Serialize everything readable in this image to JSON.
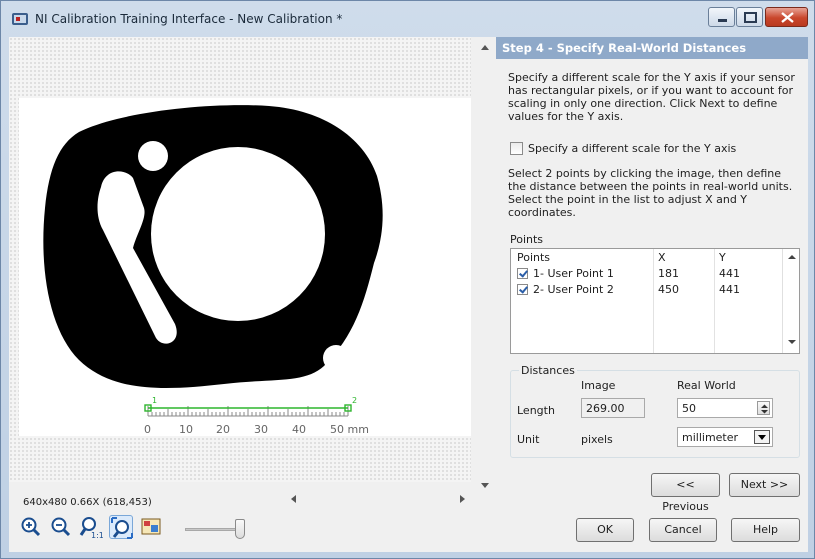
{
  "window": {
    "title": "NI Calibration Training Interface - New Calibration *"
  },
  "step": {
    "header": "Step 4 - Specify Real-World Distances",
    "description": "Specify a different scale for the Y axis if your sensor has rectangular pixels, or if you want to account for scaling in only one direction. Click Next to define values for the Y axis.",
    "checkbox_label": "Specify a different scale for the Y axis",
    "checkbox_checked": false,
    "instructions": "Select 2 points by clicking the image, then define the distance between the points in real-world units. Select the point in the list to adjust X and Y coordinates."
  },
  "points": {
    "label": "Points",
    "columns": [
      "Points",
      "X",
      "Y"
    ],
    "rows": [
      {
        "name": "1- User Point 1",
        "x": "181",
        "y": "441",
        "checked": true
      },
      {
        "name": "2- User Point 2",
        "x": "450",
        "y": "441",
        "checked": true
      }
    ]
  },
  "distances": {
    "legend": "Distances",
    "image_header": "Image",
    "real_world_header": "Real World",
    "length_label": "Length",
    "image_length": "269.00",
    "real_world_length": "50",
    "unit_label": "Unit",
    "image_unit": "pixels",
    "real_world_unit": "millimeter"
  },
  "nav": {
    "previous": "<< Previous",
    "next": "Next >>"
  },
  "footer": {
    "ok": "OK",
    "cancel": "Cancel",
    "help": "Help"
  },
  "image_info": "640x480 0.66X   (618,453)",
  "ruler": {
    "tick_labels": [
      "0",
      "10",
      "20",
      "30",
      "40",
      "50 mm"
    ],
    "point_labels": [
      "1",
      "2"
    ]
  },
  "toolbar_icons": [
    "zoom-in-icon",
    "zoom-out-icon",
    "zoom-1-1-icon",
    "zoom-fit-icon",
    "image-overlay-icon"
  ],
  "colors": {
    "header_bg": "#8fa9c9",
    "ruler": "#2db52d",
    "shape": "#000000"
  }
}
